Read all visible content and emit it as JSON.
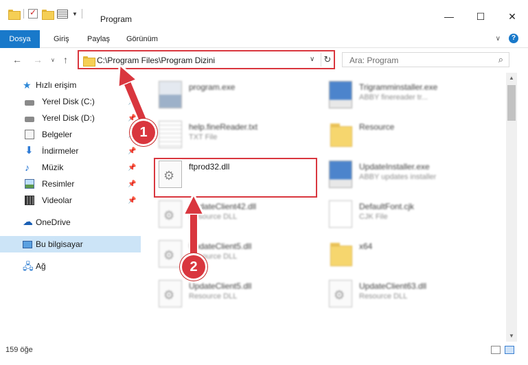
{
  "window": {
    "title": "Program"
  },
  "ribbon": {
    "tabs": [
      {
        "label": "Dosya",
        "active": true
      },
      {
        "label": "Giriş"
      },
      {
        "label": "Paylaş"
      },
      {
        "label": "Görünüm"
      }
    ]
  },
  "address": {
    "path": "C:\\Program Files\\Program Dizini"
  },
  "search": {
    "placeholder": "Ara: Program"
  },
  "sidebar": {
    "items": [
      {
        "label": "Hızlı erişim",
        "icon": "star-icon"
      },
      {
        "label": "Yerel Disk (C:)",
        "icon": "disk-icon"
      },
      {
        "label": "Yerel Disk (D:)",
        "icon": "disk-icon"
      },
      {
        "label": "Belgeler",
        "icon": "documents-icon"
      },
      {
        "label": "İndirmeler",
        "icon": "download-icon"
      },
      {
        "label": "Müzik",
        "icon": "music-icon"
      },
      {
        "label": "Resimler",
        "icon": "pictures-icon"
      },
      {
        "label": "Videolar",
        "icon": "videos-icon"
      },
      {
        "label": "OneDrive",
        "icon": "cloud-icon"
      },
      {
        "label": "Bu bilgisayar",
        "icon": "computer-icon"
      },
      {
        "label": "Ağ",
        "icon": "network-icon"
      }
    ]
  },
  "files": [
    {
      "name": "program.exe",
      "type": "",
      "icon": "exe"
    },
    {
      "name": "Trigramminstaller.exe",
      "type": "ABBY finereader tr...",
      "icon": "installer"
    },
    {
      "name": "help.fineReader.txt",
      "type": "TXT File",
      "icon": "txt"
    },
    {
      "name": "Resource",
      "type": "",
      "icon": "folder"
    },
    {
      "name": "ftprod32.dll",
      "type": "",
      "icon": "file"
    },
    {
      "name": "UpdateInstaller.exe",
      "type": "ABBY updates installer",
      "icon": "installer"
    },
    {
      "name": "UpdateClient42.dll",
      "type": "Resource DLL",
      "icon": "file"
    },
    {
      "name": "DefaultFont.cjk",
      "type": "CJK File",
      "icon": "blank"
    },
    {
      "name": "UpdateClient5.dll",
      "type": "Resource DLL",
      "icon": "file"
    },
    {
      "name": "x64",
      "type": "",
      "icon": "folder"
    },
    {
      "name": "UpdateClient5.dll",
      "type": "Resource DLL",
      "icon": "file"
    },
    {
      "name": "UpdateClient63.dll",
      "type": "Resource DLL",
      "icon": "file"
    }
  ],
  "status": {
    "item_count": "159 öğe"
  },
  "annotations": {
    "step1": "1",
    "step2": "2",
    "color": "#d9363e"
  }
}
